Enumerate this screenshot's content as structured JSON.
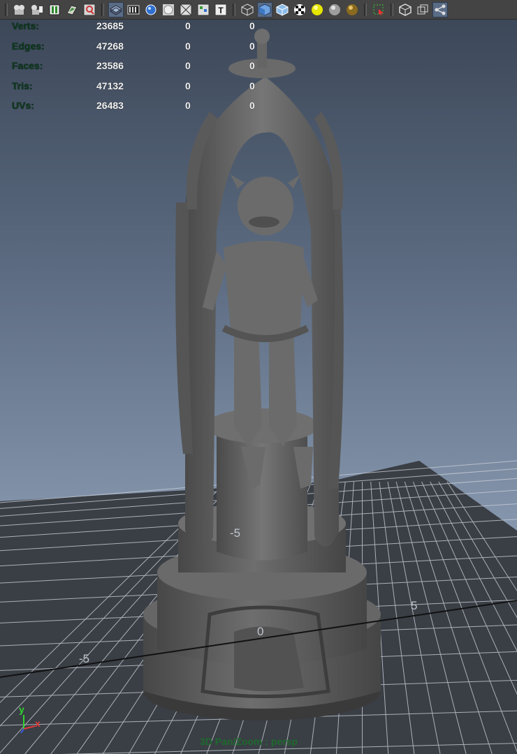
{
  "toolbar": {
    "items": [
      {
        "name": "camera-select-icon"
      },
      {
        "name": "camera-attributes-icon"
      },
      {
        "name": "bookmarks-icon"
      },
      {
        "name": "image-plane-icon"
      },
      {
        "name": "two-d-pan-zoom-icon"
      },
      {
        "name": "grid-icon"
      },
      {
        "name": "film-gate-icon"
      },
      {
        "name": "resolution-gate-icon"
      },
      {
        "name": "gate-mask-icon"
      },
      {
        "name": "field-chart-icon"
      },
      {
        "name": "safe-action-icon"
      },
      {
        "name": "safe-title-icon"
      },
      {
        "name": "wireframe-icon"
      },
      {
        "name": "smooth-shade-icon"
      },
      {
        "name": "wireframe-on-shaded-icon"
      },
      {
        "name": "textured-icon"
      },
      {
        "name": "use-all-lights-icon"
      },
      {
        "name": "shadows-icon"
      },
      {
        "name": "screen-space-ambient-occlusion-icon"
      },
      {
        "name": "isolate-select-icon"
      },
      {
        "name": "xray-icon"
      },
      {
        "name": "xray-active-components-icon"
      },
      {
        "name": "xray-joints-icon"
      }
    ]
  },
  "hud": {
    "rows": [
      {
        "label": "Verts:",
        "v1": "23685",
        "v2": "0",
        "v3": "0"
      },
      {
        "label": "Edges:",
        "v1": "47268",
        "v2": "0",
        "v3": "0"
      },
      {
        "label": "Faces:",
        "v1": "23586",
        "v2": "0",
        "v3": "0"
      },
      {
        "label": "Tris:",
        "v1": "47132",
        "v2": "0",
        "v3": "0"
      },
      {
        "label": "UVs:",
        "v1": "26483",
        "v2": "0",
        "v3": "0"
      }
    ]
  },
  "grid": {
    "labels": {
      "a": "-5",
      "b": "5",
      "c": "0",
      "d": "-5"
    }
  },
  "axis": {
    "y": "y",
    "x": "x",
    "y_color": "#2fd62f",
    "x_color": "#e23a3a",
    "z_color": "#3a5fe2"
  },
  "camera_label": "3D Pan/Zoom : persp"
}
